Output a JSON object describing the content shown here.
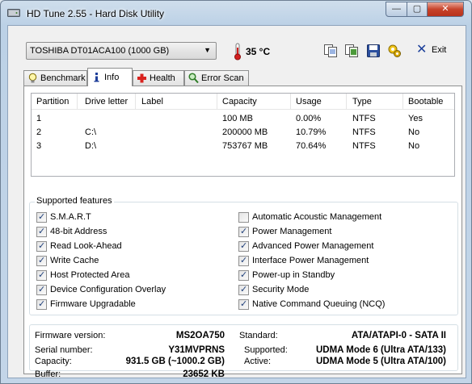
{
  "window": {
    "title": "HD Tune 2.55 - Hard Disk Utility",
    "min_glyph": "—",
    "max_glyph": "▢",
    "close_glyph": "✕"
  },
  "toolbar": {
    "drive": "TOSHIBA DT01ACA100 (1000 GB)",
    "temperature": "35 °C",
    "exit_label": "Exit",
    "icons": [
      "copy-text-icon",
      "copy-screenshot-icon",
      "save-icon",
      "options-icon"
    ]
  },
  "tabs": [
    {
      "label": "Benchmark",
      "icon": "lightbulb-icon",
      "active": false
    },
    {
      "label": "Info",
      "icon": "info-icon",
      "active": true
    },
    {
      "label": "Health",
      "icon": "health-cross-icon",
      "active": false
    },
    {
      "label": "Error Scan",
      "icon": "magnifier-icon",
      "active": false
    }
  ],
  "partitions": {
    "headers": [
      "Partition",
      "Drive letter",
      "Label",
      "Capacity",
      "Usage",
      "Type",
      "Bootable"
    ],
    "rows": [
      [
        "1",
        "",
        "",
        "100 MB",
        "0.00%",
        "NTFS",
        "Yes"
      ],
      [
        "2",
        "C:\\",
        "",
        "200000 MB",
        "10.79%",
        "NTFS",
        "No"
      ],
      [
        "3",
        "D:\\",
        "",
        "753767 MB",
        "70.64%",
        "NTFS",
        "No"
      ]
    ]
  },
  "features": {
    "title": "Supported features",
    "left": [
      {
        "label": "S.M.A.R.T",
        "checked": true
      },
      {
        "label": "48-bit Address",
        "checked": true
      },
      {
        "label": "Read Look-Ahead",
        "checked": true
      },
      {
        "label": "Write Cache",
        "checked": true
      },
      {
        "label": "Host Protected Area",
        "checked": true
      },
      {
        "label": "Device Configuration Overlay",
        "checked": true
      },
      {
        "label": "Firmware Upgradable",
        "checked": true
      }
    ],
    "right": [
      {
        "label": "Automatic Acoustic Management",
        "checked": false
      },
      {
        "label": "Power Management",
        "checked": true
      },
      {
        "label": "Advanced Power Management",
        "checked": true
      },
      {
        "label": "Interface Power Management",
        "checked": true
      },
      {
        "label": "Power-up in Standby",
        "checked": true
      },
      {
        "label": "Security Mode",
        "checked": true
      },
      {
        "label": "Native Command Queuing (NCQ)",
        "checked": true
      }
    ]
  },
  "info": {
    "firmware_label": "Firmware version:",
    "firmware": "MS2OA750",
    "serial_label": "Serial number:",
    "serial": "Y31MVPRNS",
    "capacity_label": "Capacity:",
    "capacity": "931.5 GB (~1000.2 GB)",
    "buffer_label": "Buffer:",
    "buffer": "23652 KB",
    "standard_label": "Standard:",
    "standard": "ATA/ATAPI-0 - SATA II",
    "supported_label": "Supported:",
    "supported": "UDMA Mode 6 (Ultra ATA/133)",
    "active_label": "Active:",
    "active": "UDMA Mode 5 (Ultra ATA/100)"
  }
}
